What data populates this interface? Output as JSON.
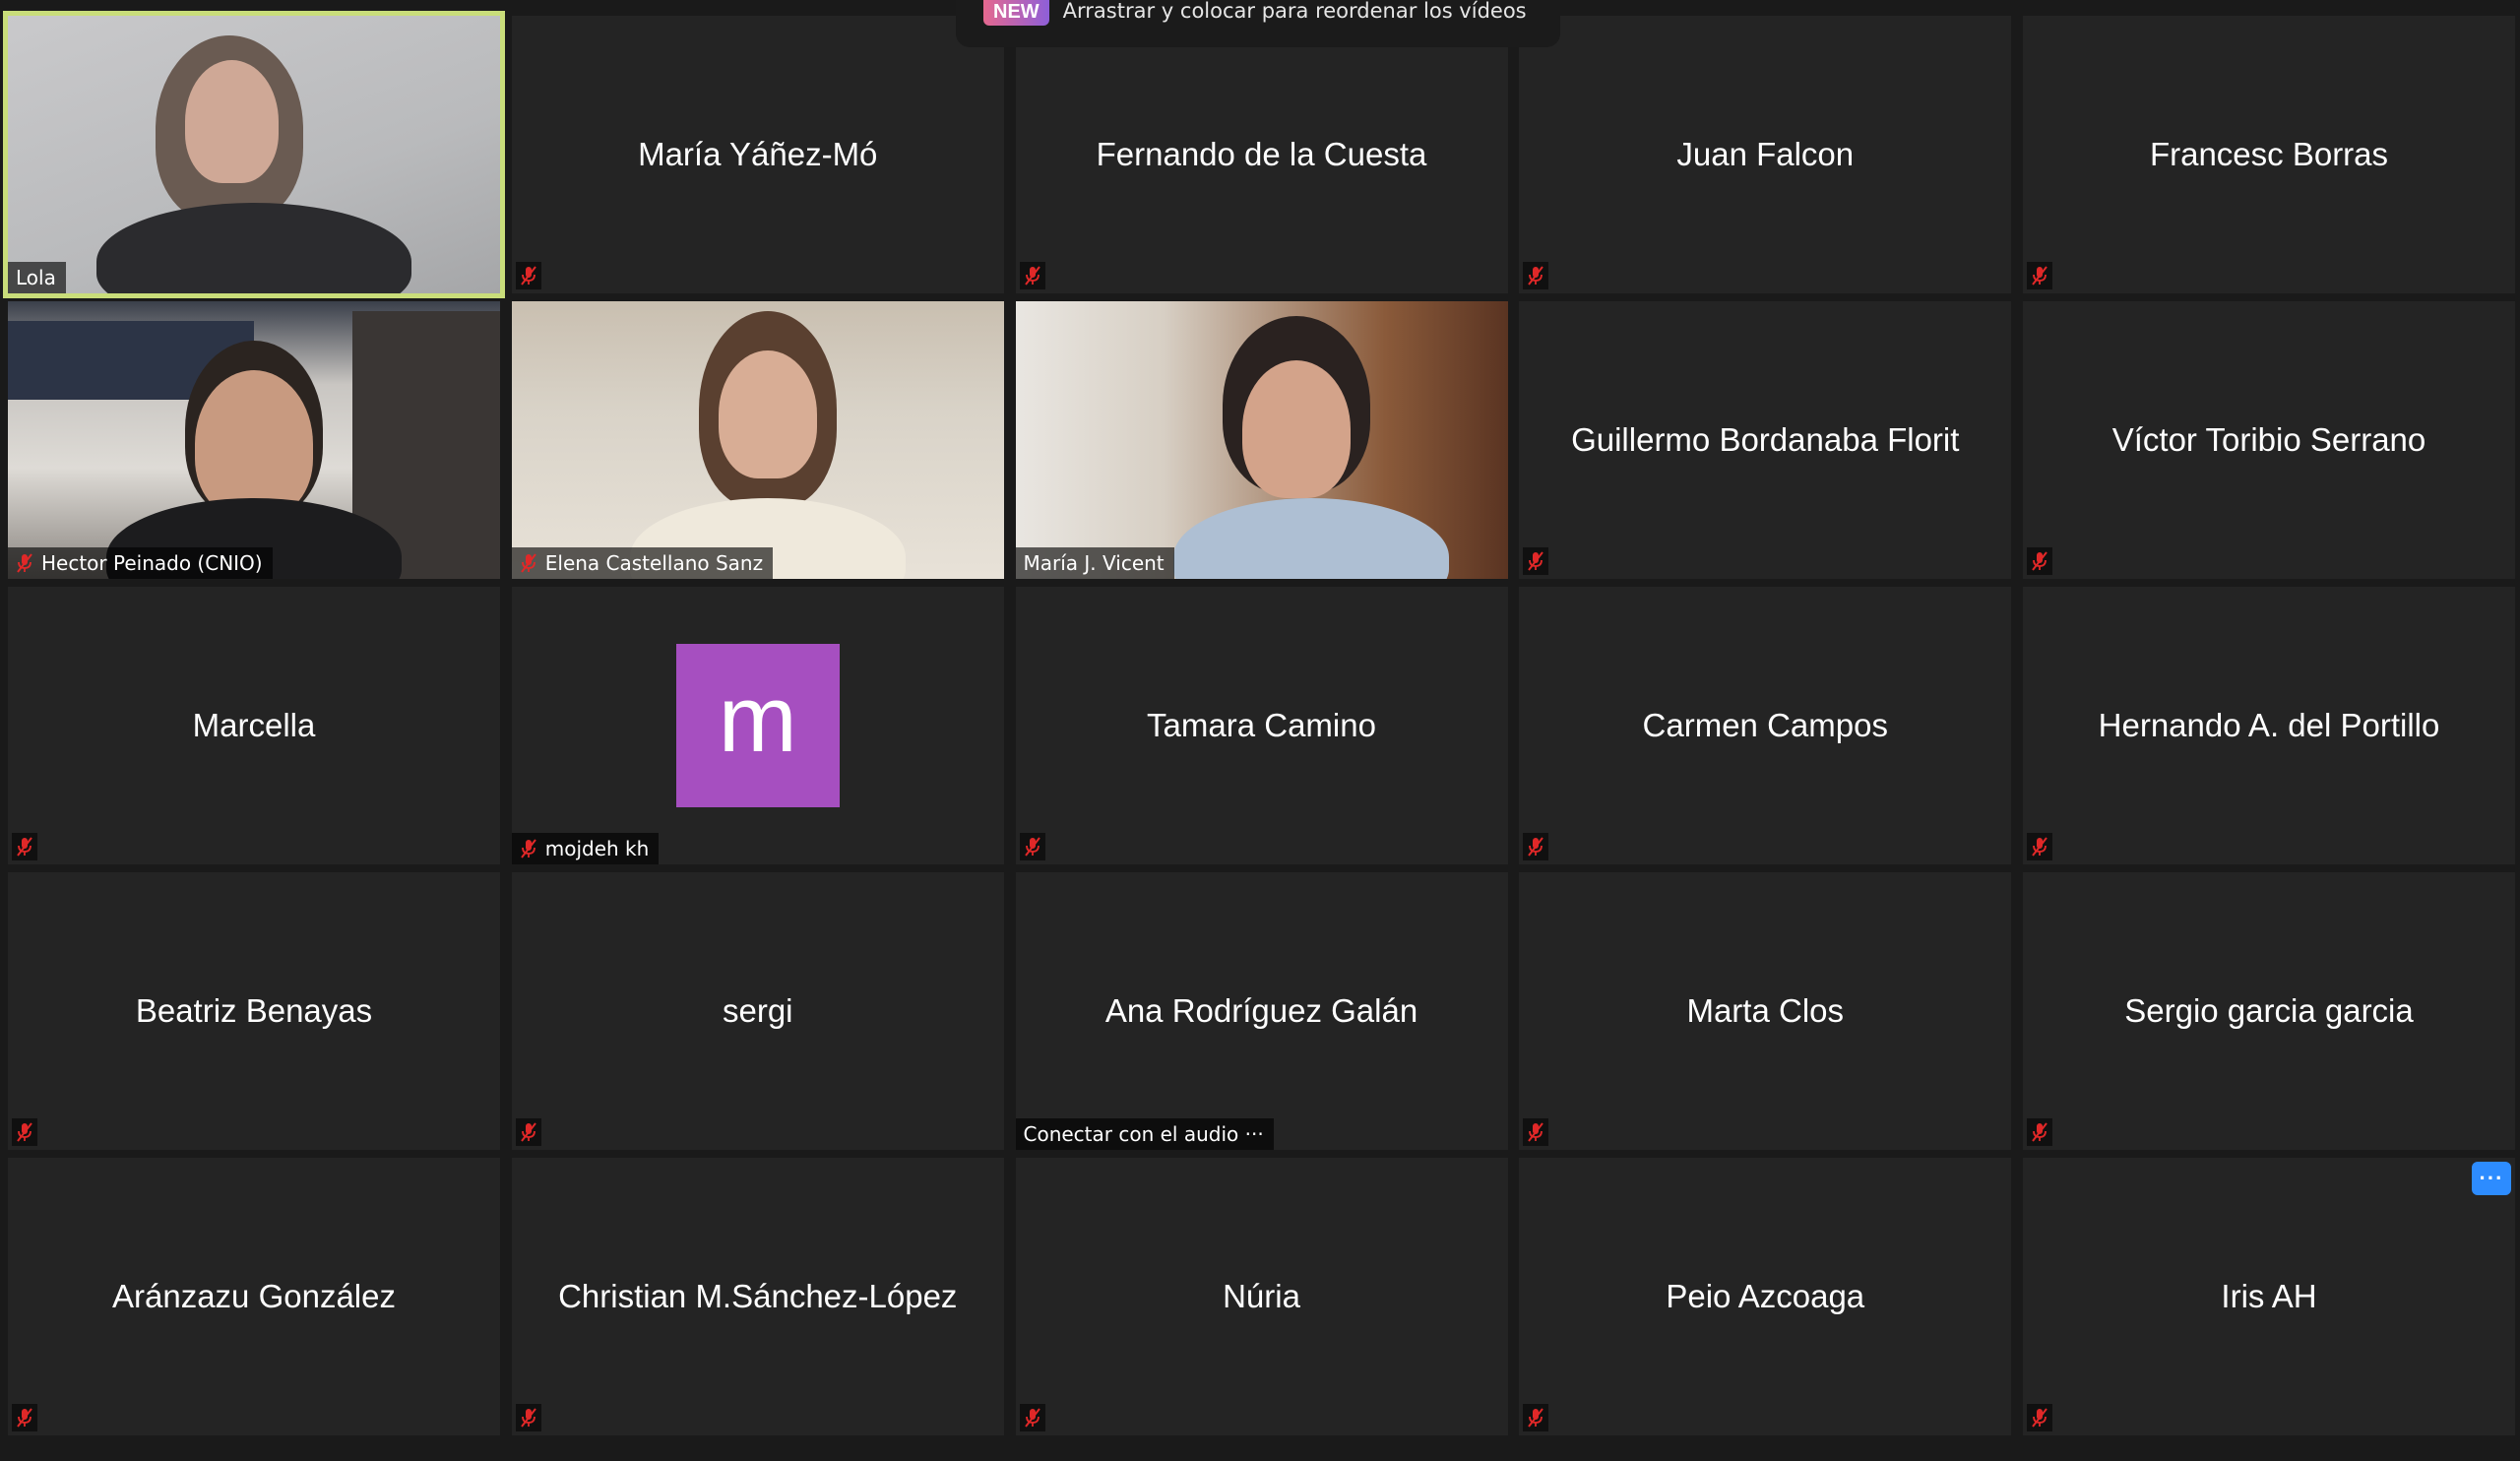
{
  "notice": {
    "badge": "NEW",
    "text": "Arrastrar y colocar para reordenar los vídeos"
  },
  "colors": {
    "background": "#1a1a1a",
    "tile": "#242424",
    "active_speaker_border": "#c9dd7a",
    "muted_icon": "#e02828",
    "avatar_bg": "#a64fc0",
    "more_button": "#2d8cff"
  },
  "participants": [
    {
      "name": "Lola",
      "video": true,
      "muted": false,
      "active_speaker": true
    },
    {
      "name": "María Yáñez-Mó",
      "video": false,
      "muted": true
    },
    {
      "name": "Fernando de la Cuesta",
      "video": false,
      "muted": true
    },
    {
      "name": "Juan Falcon",
      "video": false,
      "muted": true
    },
    {
      "name": "Francesc Borras",
      "video": false,
      "muted": true
    },
    {
      "name": "Hector Peinado (CNIO)",
      "video": true,
      "muted": true
    },
    {
      "name": "Elena Castellano Sanz",
      "video": true,
      "muted": true
    },
    {
      "name": "María J. Vicent",
      "video": true,
      "muted": false
    },
    {
      "name": "Guillermo Bordanaba Florit",
      "video": false,
      "muted": true
    },
    {
      "name": "Víctor Toribio Serrano",
      "video": false,
      "muted": true
    },
    {
      "name": "Marcella",
      "video": false,
      "muted": true
    },
    {
      "name": "mojdeh kh",
      "video": false,
      "muted": true,
      "avatar_letter": "m"
    },
    {
      "name": "Tamara Camino",
      "video": false,
      "muted": true
    },
    {
      "name": "Carmen Campos",
      "video": false,
      "muted": true
    },
    {
      "name": "Hernando A. del Portillo",
      "video": false,
      "muted": true
    },
    {
      "name": "Beatriz Benayas",
      "video": false,
      "muted": true
    },
    {
      "name": "sergi",
      "video": false,
      "muted": true
    },
    {
      "name": "Ana Rodríguez Galán",
      "video": false,
      "muted": false,
      "audio_status": "Conectar con el audio ···"
    },
    {
      "name": "Marta Clos",
      "video": false,
      "muted": true
    },
    {
      "name": "Sergio garcia garcia",
      "video": false,
      "muted": true
    },
    {
      "name": "Aránzazu González",
      "video": false,
      "muted": true
    },
    {
      "name": "Christian M.Sánchez-López",
      "video": false,
      "muted": true
    },
    {
      "name": "Núria",
      "video": false,
      "muted": true
    },
    {
      "name": "Peio Azcoaga",
      "video": false,
      "muted": true
    },
    {
      "name": "Iris AH",
      "video": false,
      "muted": true,
      "more_button": "···"
    }
  ]
}
